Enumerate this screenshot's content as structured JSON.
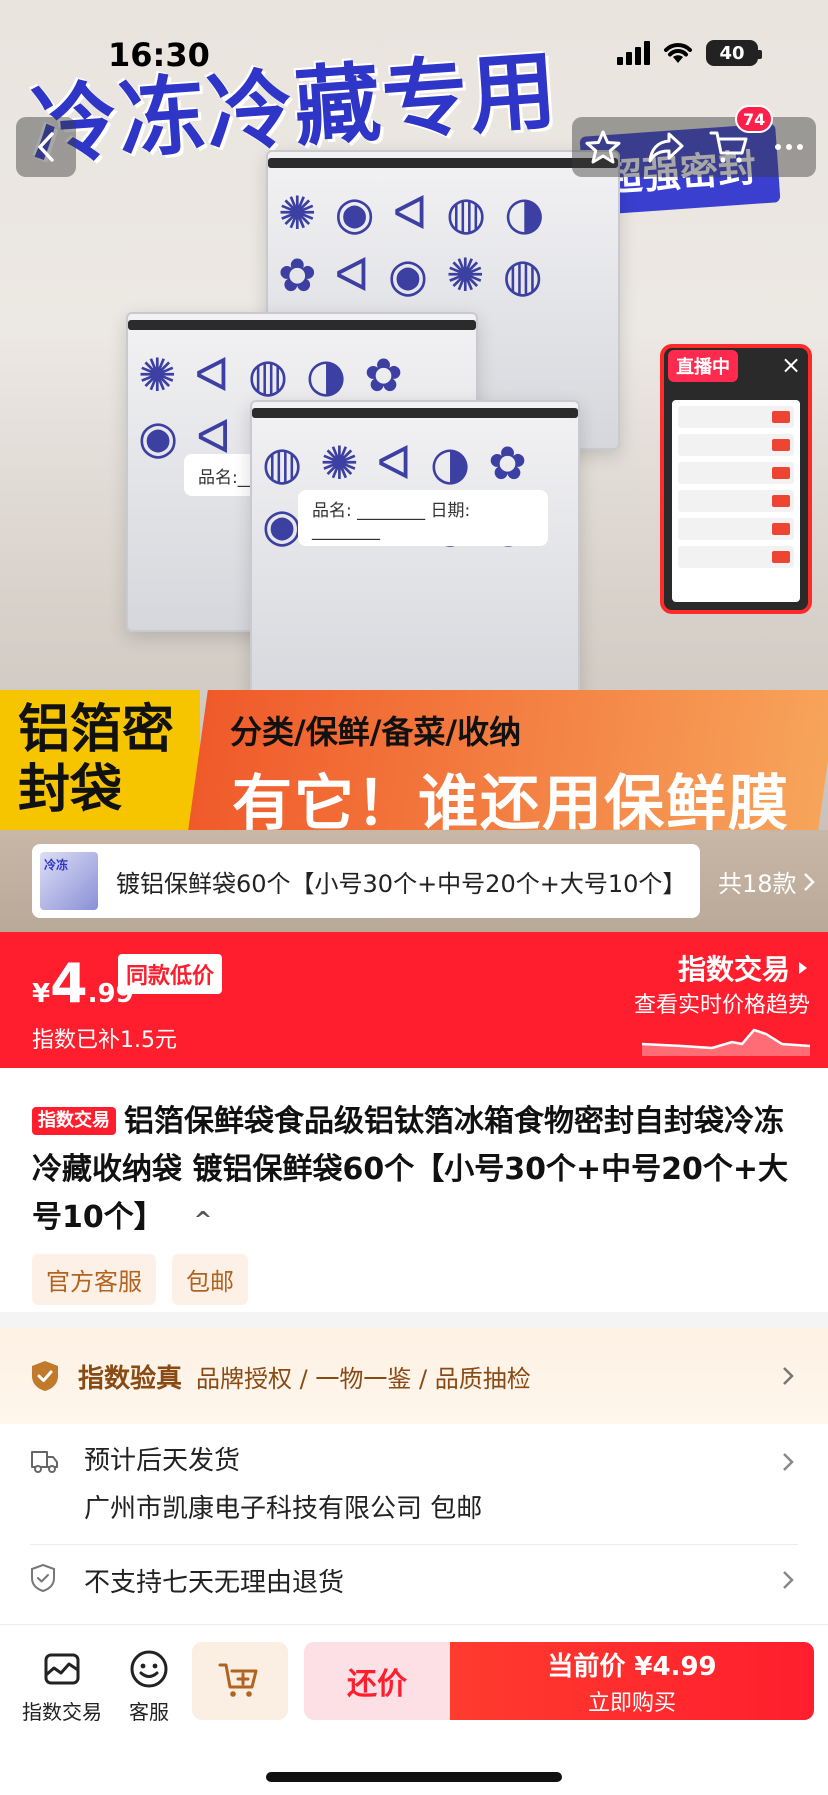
{
  "status_bar": {
    "time": "16:30",
    "battery": "40"
  },
  "hero": {
    "banner_title": "冷冻冷藏专用",
    "banner_tag": "超强密封",
    "bag_label_small": "品名:___",
    "bag_label_large": "品名: ________  日期: ________",
    "promo_left": "铝箔密封袋",
    "promo_sub": "分类/保鲜/备菜/收纳",
    "promo_main": "有它！谁还用保鲜膜"
  },
  "nav": {
    "cart_count": "74"
  },
  "live": {
    "badge": "直播中",
    "close": "×"
  },
  "variant": {
    "name": "镀铝保鲜袋60个【小号30个+中号20个+大号10个】",
    "total": "共18款"
  },
  "price": {
    "currency": "¥",
    "integer": "4",
    "decimal": ".99",
    "badge": "同款低价",
    "subsidy": "指数已补1.5元",
    "trade_title": "指数交易",
    "trade_sub": "查看实时价格趋势"
  },
  "product": {
    "tag": "指数交易",
    "title": "铝箔保鲜袋食品级铝钛箔冰箱食物密封自封袋冷冻冷藏收纳袋 镀铝保鲜袋60个【小号30个+中号20个+大号10个】",
    "caret": "^",
    "chips": [
      "官方客服",
      "包邮"
    ]
  },
  "verify": {
    "title": "指数验真",
    "items": "品牌授权 / 一物一鉴 / 品质抽检"
  },
  "shipping": {
    "line1": "预计后天发货",
    "line2": "广州市凯康电子科技有限公司  包邮",
    "returns": "不支持七天无理由退货"
  },
  "action_bar": {
    "index_trade": "指数交易",
    "service": "客服",
    "bargain": "还价",
    "buy_price_label": "当前价 ¥4.99",
    "buy_now": "立即购买"
  },
  "colors": {
    "accent": "#ff1e2d",
    "brand_blue": "#2f35c7",
    "verify_brown": "#8a4a14"
  }
}
